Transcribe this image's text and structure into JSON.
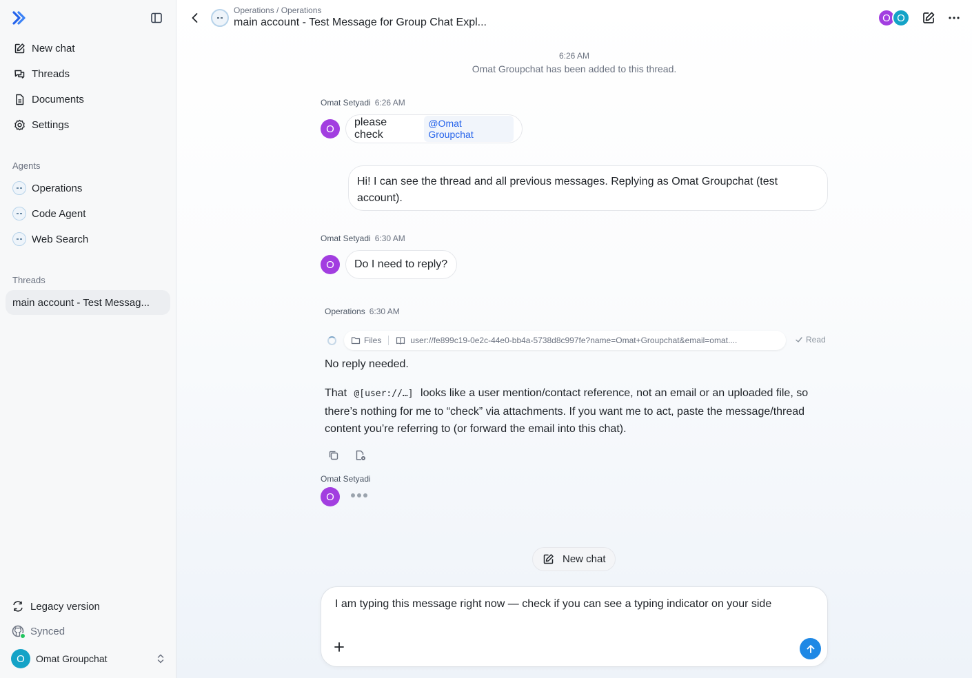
{
  "sidebar": {
    "nav": [
      {
        "label": "New chat",
        "icon": "edit-icon"
      },
      {
        "label": "Threads",
        "icon": "chat-bubbles-icon"
      },
      {
        "label": "Documents",
        "icon": "document-icon"
      },
      {
        "label": "Settings",
        "icon": "gear-icon"
      }
    ],
    "agents_label": "Agents",
    "agents": [
      {
        "label": "Operations"
      },
      {
        "label": "Code Agent"
      },
      {
        "label": "Web Search"
      }
    ],
    "threads_label": "Threads",
    "threads": [
      {
        "label": "main account - Test Messag..."
      }
    ],
    "legacy_label": "Legacy version",
    "synced_label": "Synced",
    "user": {
      "initial": "O",
      "name": "Omat Groupchat"
    }
  },
  "header": {
    "breadcrumb": "Operations / Operations",
    "title": "main account - Test Message for Group Chat Expl...",
    "participants": [
      {
        "initial": "O",
        "color": "#a23ee0"
      },
      {
        "initial": "O",
        "color": "#14a3c7"
      }
    ]
  },
  "conversation": {
    "system_time": "6:26 AM",
    "system_message": "Omat Groupchat has been added to this thread.",
    "msg1": {
      "author": "Omat Setyadi",
      "time": "6:26 AM",
      "initial": "O",
      "text": "please check",
      "mention": "@Omat Groupchat"
    },
    "reply1": {
      "text": "Hi! I can see the thread and all previous messages. Replying as Omat Groupchat (test account)."
    },
    "msg2": {
      "author": "Omat Setyadi",
      "time": "6:30 AM",
      "initial": "O",
      "text": "Do I need to reply?"
    },
    "agent": {
      "author": "Operations",
      "time": "6:30 AM",
      "tool_files": "Files",
      "tool_path": "user://fe899c19-0e2c-44e0-bb4a-5738d8c997fe?name=Omat+Groupchat&email=omat....",
      "tool_status": "Read",
      "para1": "No reply needed.",
      "para2_before": "That",
      "para2_code": "@[user://…]",
      "para2_after": "looks like a user mention/contact reference, not an email or an uploaded file, so there’s nothing for me to “check” via attachments. If you want me to act, paste the message/thread content you’re referring to (or forward the email into this chat)."
    },
    "msg3": {
      "author": "Omat Setyadi",
      "initial": "O"
    }
  },
  "new_chat_label": "New chat",
  "composer": {
    "text": "I am typing this message right now — check if you can see a typing indicator on your side"
  },
  "colors": {
    "accent": "#1e88e5",
    "user_purple": "#a23ee0",
    "user_teal": "#14a3c7",
    "logo_blue": "#2563eb"
  }
}
